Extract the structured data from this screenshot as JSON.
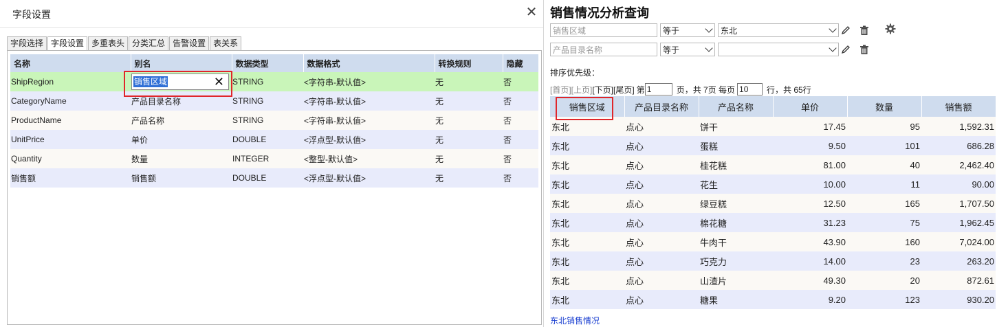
{
  "dialog": {
    "title": "字段设置",
    "close_glyph": "✕",
    "tabs": [
      "字段选择",
      "字段设置",
      "多重表头",
      "分类汇总",
      "告警设置",
      "表关系"
    ],
    "active_tab": 1,
    "columns": [
      "名称",
      "别名",
      "数据类型",
      "数据格式",
      "转换规则",
      "隐藏"
    ],
    "rows": [
      {
        "name": "ShipRegion",
        "alias": "销售区域",
        "type": "STRING",
        "format": "<字符串-默认值>",
        "rule": "无",
        "hidden": "否"
      },
      {
        "name": "CategoryName",
        "alias": "产品目录名称",
        "type": "STRING",
        "format": "<字符串-默认值>",
        "rule": "无",
        "hidden": "否"
      },
      {
        "name": "ProductName",
        "alias": "产品名称",
        "type": "STRING",
        "format": "<字符串-默认值>",
        "rule": "无",
        "hidden": "否"
      },
      {
        "name": "UnitPrice",
        "alias": "单价",
        "type": "DOUBLE",
        "format": "<浮点型-默认值>",
        "rule": "无",
        "hidden": "否"
      },
      {
        "name": "Quantity",
        "alias": "数量",
        "type": "INTEGER",
        "format": "<整型-默认值>",
        "rule": "无",
        "hidden": "否"
      },
      {
        "name": "销售额",
        "alias": "销售额",
        "type": "DOUBLE",
        "format": "<浮点型-默认值>",
        "rule": "无",
        "hidden": "否"
      }
    ],
    "alias_clear_glyph": "✕"
  },
  "report": {
    "title": "销售情况分析查询",
    "filters": [
      {
        "field": "销售区域",
        "op": "等于",
        "value": "东北"
      },
      {
        "field": "产品目录名称",
        "op": "等于",
        "value": ""
      }
    ],
    "icons": {
      "edit": "pencil-icon",
      "delete": "trash-icon",
      "settings": "gear-icon"
    },
    "sort_label": "排序优先级：",
    "pager": {
      "first": "[首页]",
      "prev": "[上页]",
      "next": "[下页]",
      "last": "[尾页]",
      "page_prefix": "第",
      "page": "1",
      "page_suffix": "页，共 7页 每页",
      "per_page": "10",
      "total_text": "行，共 65行"
    },
    "columns": [
      "销售区域",
      "产品目录名称",
      "产品名称",
      "单价",
      "数量",
      "销售额"
    ],
    "rows": [
      [
        "东北",
        "点心",
        "饼干",
        "17.45",
        "95",
        "1,592.31"
      ],
      [
        "东北",
        "点心",
        "蛋糕",
        "9.50",
        "101",
        "686.28"
      ],
      [
        "东北",
        "点心",
        "桂花糕",
        "81.00",
        "40",
        "2,462.40"
      ],
      [
        "东北",
        "点心",
        "花生",
        "10.00",
        "11",
        "90.00"
      ],
      [
        "东北",
        "点心",
        "绿豆糕",
        "12.50",
        "165",
        "1,707.50"
      ],
      [
        "东北",
        "点心",
        "棉花糖",
        "31.23",
        "75",
        "1,962.45"
      ],
      [
        "东北",
        "点心",
        "牛肉干",
        "43.90",
        "160",
        "7,024.00"
      ],
      [
        "东北",
        "点心",
        "巧克力",
        "14.00",
        "23",
        "263.20"
      ],
      [
        "东北",
        "点心",
        "山渣片",
        "49.30",
        "20",
        "872.61"
      ],
      [
        "东北",
        "点心",
        "糖果",
        "9.20",
        "123",
        "930.20"
      ]
    ],
    "footer_link": "东北销售情况"
  },
  "colors": {
    "highlight_border": "#e0262a",
    "header_bg": "#cfdcee",
    "selected_row": "#c9f5b9",
    "link": "#1a3fd0"
  }
}
